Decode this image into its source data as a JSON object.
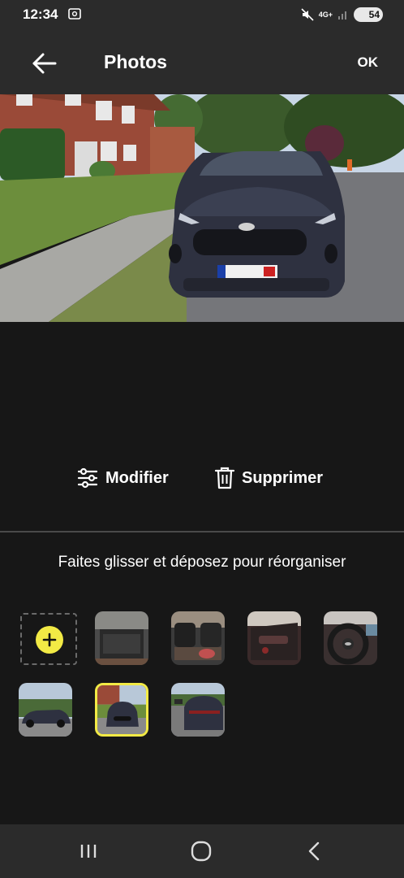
{
  "status_bar": {
    "time": "12:34",
    "network": "4G+",
    "battery": "54"
  },
  "header": {
    "title": "Photos",
    "ok_label": "OK",
    "back_icon": "arrow-left-icon"
  },
  "actions": {
    "modify_label": "Modifier",
    "delete_label": "Supprimer"
  },
  "hint": "Faites glisser et déposez pour réorganiser",
  "colors": {
    "accent": "#f2ea45",
    "background": "#171717",
    "bar": "#2b2b2b"
  },
  "thumbnails": [
    {
      "subject": "trunk"
    },
    {
      "subject": "rear-seats"
    },
    {
      "subject": "door-panel"
    },
    {
      "subject": "steering-wheel"
    },
    {
      "subject": "car-side"
    },
    {
      "subject": "car-front",
      "selected": true
    },
    {
      "subject": "car-rear"
    }
  ],
  "nav_bar": [
    "recent-apps-icon",
    "home-icon",
    "back-icon"
  ]
}
